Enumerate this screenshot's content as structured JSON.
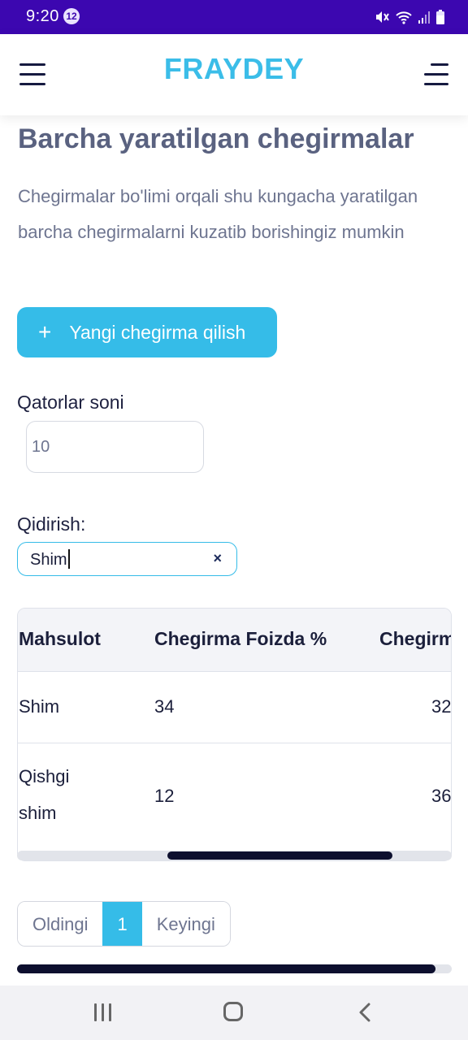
{
  "status_bar": {
    "time": "9:20",
    "notification_count": "12",
    "icons": [
      "mute-icon",
      "wifi-icon",
      "signal-icon",
      "battery-icon"
    ]
  },
  "header": {
    "brand": "FRAYDEY",
    "brand_color": "#3bbde8",
    "left_icon": "hamburger-menu-icon",
    "right_icon": "menu-right-icon"
  },
  "page": {
    "title": "Barcha yaratilgan chegirmalar",
    "description": "Chegirmalar bo'limi orqali shu kungacha yaratilgan barcha chegirmalarni kuzatib borishingiz mumkin",
    "new_button": {
      "icon": "plus-icon",
      "label": "Yangi chegirma qilish",
      "plus": "+"
    },
    "rows": {
      "label": "Qatorlar soni",
      "value": "10"
    },
    "search": {
      "label": "Qidirish:",
      "value": "Shim",
      "clear": "×"
    }
  },
  "table": {
    "columns": [
      "Mahsulot",
      "Chegirma Foizda %",
      "Chegirm"
    ],
    "rows": [
      {
        "product_lines": [
          "Shim"
        ],
        "percent": "34",
        "third": "32"
      },
      {
        "product_lines": [
          "Qishgi",
          "shim"
        ],
        "percent": "12",
        "third": "36"
      }
    ]
  },
  "pagination": {
    "prev": "Oldingi",
    "current": "1",
    "next": "Keyingi"
  },
  "colors": {
    "accent": "#35bce8",
    "status_bar": "#3c07b0",
    "text_dark": "#1b1f3b"
  }
}
